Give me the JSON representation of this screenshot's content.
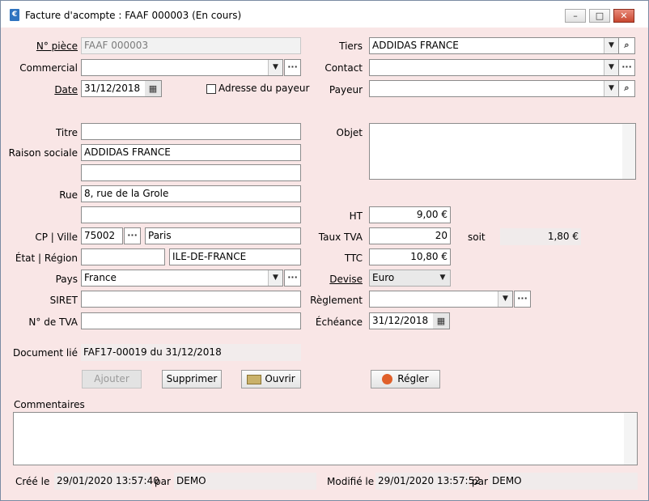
{
  "window": {
    "title": "Facture d'acompte : FAAF 000003 (En cours)",
    "app_icon_glyph": "€"
  },
  "left": {
    "piece_label": "N° pièce",
    "piece_value": "FAAF 000003",
    "commercial_label": "Commercial",
    "commercial_value": "",
    "date_label": "Date",
    "date_value": "31/12/2018",
    "titre_label": "Titre",
    "titre_value": "",
    "raison_label": "Raison sociale",
    "raison_value": "ADDIDAS FRANCE",
    "raison2_value": "",
    "rue_label": "Rue",
    "rue_value": "8, rue de la Grole",
    "rue2_value": "",
    "cp_label": "CP | Ville",
    "cp_value": "75002",
    "ville_value": "Paris",
    "etat_label": "État | Région",
    "etat_value": "",
    "region_value": "ILE-DE-FRANCE",
    "pays_label": "Pays",
    "pays_value": "France",
    "siret_label": "SIRET",
    "siret_value": "",
    "tva_label": "N° de TVA",
    "tva_value": "",
    "doc_lie_label": "Document lié",
    "doc_lie_value": "FAF17-00019 du 31/12/2018"
  },
  "adresse_payeur": {
    "label": "Adresse du payeur",
    "checked": false
  },
  "right": {
    "tiers_label": "Tiers",
    "tiers_value": "ADDIDAS FRANCE",
    "contact_label": "Contact",
    "contact_value": "",
    "payeur_label": "Payeur",
    "payeur_value": "",
    "objet_label": "Objet",
    "objet_value": "",
    "ht_label": "HT",
    "ht_value": "9,00 €",
    "taux_label": "Taux TVA",
    "taux_value": "20",
    "soit_label": "soit",
    "soit_value": "1,80 €",
    "ttc_label": "TTC",
    "ttc_value": "10,80 €",
    "devise_label": "Devise",
    "devise_value": "Euro",
    "reglement_label": "Règlement",
    "reglement_value": "",
    "echeance_label": "Échéance",
    "echeance_value": "31/12/2018"
  },
  "buttons": {
    "ajouter": "Ajouter",
    "supprimer": "Supprimer",
    "ouvrir": "Ouvrir",
    "regler": "Régler"
  },
  "commentaires": {
    "label": "Commentaires",
    "value": ""
  },
  "footer": {
    "cree_label": "Créé le",
    "cree_date": "29/01/2020 13:57:40",
    "cree_par_label": "par",
    "cree_par": "DEMO",
    "modifie_label": "Modifié le",
    "modifie_date": "29/01/2020 13:57:52",
    "modifie_par_label": "par",
    "modifie_par": "DEMO"
  },
  "icons": {
    "dropdown": "▼",
    "more": "···",
    "search": "⌕",
    "calendar": "▦",
    "minimize": "–",
    "maximize": "□",
    "close": "✕"
  }
}
